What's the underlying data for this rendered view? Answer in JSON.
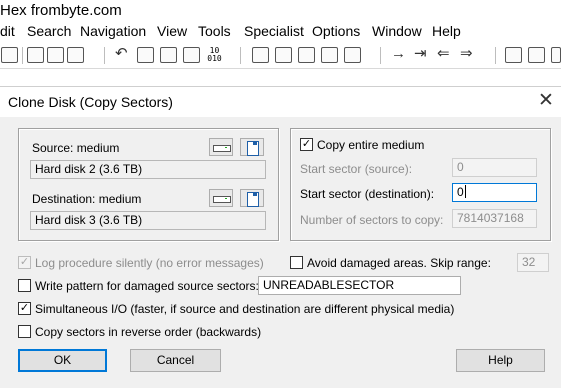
{
  "app": {
    "title": "Hex  frombyte.com"
  },
  "menu": {
    "items": [
      "dit",
      "Search",
      "Navigation",
      "View",
      "Tools",
      "Specialist",
      "Options",
      "Window",
      "Help"
    ]
  },
  "toolbar": {
    "icons": [
      "save-icon",
      "print-icon",
      "properties-icon",
      "edit-icon",
      "undo-icon",
      "copy-icon",
      "paste-icon",
      "paste-special-icon",
      "binary-icon",
      "find-icon",
      "find-hex-icon",
      "replace-text-icon",
      "replace-hex-icon",
      "find-next-icon",
      "goto-offset-icon",
      "goto-sector-icon",
      "back-icon",
      "forward-icon",
      "disk-edit-icon",
      "windows-icon",
      "more-icon"
    ],
    "binary_label": "10\n010"
  },
  "dialog": {
    "title": "Clone Disk (Copy Sectors)",
    "close_glyph": "✕",
    "source": {
      "label": "Source: medium",
      "value": "Hard disk 2 (3.6 TB)"
    },
    "destination": {
      "label": "Destination: medium",
      "value": "Hard disk 3 (3.6 TB)"
    },
    "copy_entire_medium": {
      "label": "Copy entire medium",
      "checked": true
    },
    "start_sector_source": {
      "label": "Start sector (source):",
      "value": "0"
    },
    "start_sector_destination": {
      "label": "Start sector (destination):",
      "value": "0"
    },
    "num_sectors": {
      "label": "Number of sectors to copy:",
      "value": "7814037168"
    },
    "log_silently": {
      "label": "Log procedure silently (no error messages)",
      "checked": true,
      "disabled": true
    },
    "avoid_damaged": {
      "label": "Avoid damaged areas. Skip range:",
      "checked": false,
      "range_value": "32"
    },
    "write_pattern": {
      "label": "Write pattern for damaged source sectors:",
      "checked": false,
      "pattern_value": "UNREADABLESECTOR"
    },
    "simultaneous_io": {
      "label": "Simultaneous I/O (faster, if source and destination are different physical media)",
      "checked": true
    },
    "reverse_order": {
      "label": "Copy sectors in reverse order (backwards)",
      "checked": false
    },
    "buttons": {
      "ok": "OK",
      "cancel": "Cancel",
      "help": "Help"
    }
  }
}
